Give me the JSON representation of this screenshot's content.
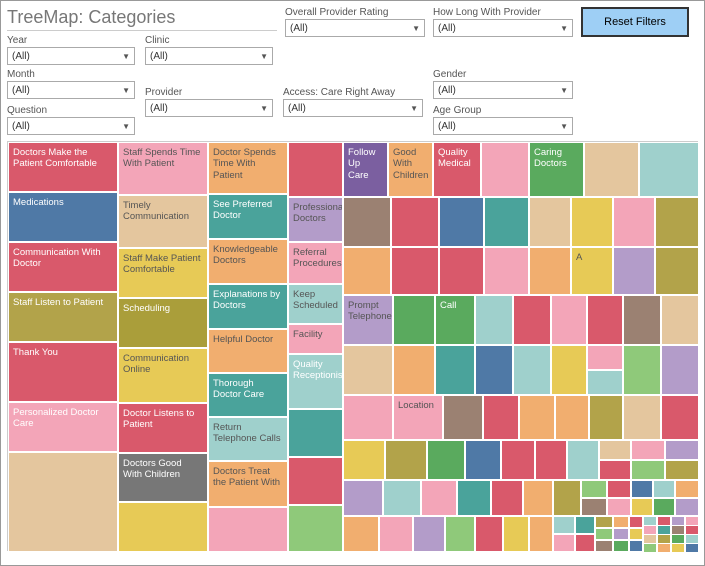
{
  "title": "TreeMap: Categories",
  "reset_button": "Reset Filters",
  "filters": {
    "year": {
      "label": "Year",
      "value": "(All)"
    },
    "clinic": {
      "label": "Clinic",
      "value": "(All)"
    },
    "month": {
      "label": "Month",
      "value": "(All)"
    },
    "provider": {
      "label": "Provider",
      "value": "(All)"
    },
    "question": {
      "label": "Question",
      "value": "(All)"
    },
    "overall_rating": {
      "label": "Overall Provider Rating",
      "value": "(All)"
    },
    "how_long": {
      "label": "How Long With Provider",
      "value": "(All)"
    },
    "access": {
      "label": "Access: Care Right Away",
      "value": "(All)"
    },
    "gender": {
      "label": "Gender",
      "value": "(All)"
    },
    "age_group": {
      "label": "Age Group",
      "value": "(All)"
    }
  },
  "chart_data": {
    "type": "treemap",
    "title": "TreeMap: Categories",
    "series": [
      {
        "name": "Doctors Make the Patient Comfortable",
        "value": 100,
        "color": "#d9596b"
      },
      {
        "name": "Medications",
        "value": 90,
        "color": "#4f79a6"
      },
      {
        "name": "Communication With Doctor",
        "value": 88,
        "color": "#d9596b"
      },
      {
        "name": "Staff Listen to Patient",
        "value": 85,
        "color": "#b2a34a"
      },
      {
        "name": "Thank You",
        "value": 84,
        "color": "#d9596b"
      },
      {
        "name": "Personalized Doctor Care",
        "value": 70,
        "color": "#f3a5b8"
      },
      {
        "name": "Staff Spends Time With Patient",
        "value": 78,
        "color": "#f3a5b8"
      },
      {
        "name": "Timely Communication",
        "value": 72,
        "color": "#e4c69e"
      },
      {
        "name": "Staff Make Patient Comfortable",
        "value": 70,
        "color": "#e7ca56"
      },
      {
        "name": "Scheduling",
        "value": 68,
        "color": "#aa9e3a"
      },
      {
        "name": "Communication Online",
        "value": 65,
        "color": "#e7ca56"
      },
      {
        "name": "Doctor Listens to Patient",
        "value": 60,
        "color": "#d9596b"
      },
      {
        "name": "Doctors Good With Children",
        "value": 55,
        "color": "#777"
      },
      {
        "name": "Doctor Spends Time With Patient",
        "value": 62,
        "color": "#f1ae6f"
      },
      {
        "name": "See Preferred Doctor",
        "value": 55,
        "color": "#4aa39b"
      },
      {
        "name": "Knowledgeable Doctors",
        "value": 52,
        "color": "#f1ae6f"
      },
      {
        "name": "Explanations by Doctors",
        "value": 50,
        "color": "#4aa39b"
      },
      {
        "name": "Helpful Doctor",
        "value": 48,
        "color": "#f1ae6f"
      },
      {
        "name": "Thorough Doctor Care",
        "value": 46,
        "color": "#4aa39b"
      },
      {
        "name": "Return Telephone Calls",
        "value": 44,
        "color": "#9fd0cc"
      },
      {
        "name": "Doctors Treat the Patient With",
        "value": 42,
        "color": "#f1ae6f"
      },
      {
        "name": "Professional Doctors",
        "value": 42,
        "color": "#b39cc9"
      },
      {
        "name": "Referral Procedures",
        "value": 40,
        "color": "#f3a5b8"
      },
      {
        "name": "Keep Scheduled",
        "value": 38,
        "color": "#9fd0cc"
      },
      {
        "name": "Facility",
        "value": 36,
        "color": "#f3a5b8"
      },
      {
        "name": "Quality Receptionists",
        "value": 40,
        "color": "#9fd0cc"
      },
      {
        "name": "Follow Up Care",
        "value": 40,
        "color": "#7b5fa0"
      },
      {
        "name": "Good With Children",
        "value": 38,
        "color": "#f1ae6f"
      },
      {
        "name": "Quality Medical",
        "value": 38,
        "color": "#d9596b"
      },
      {
        "name": "Caring Doctors",
        "value": 36,
        "color": "#5aaa5e"
      },
      {
        "name": "Prompt Telephone",
        "value": 35,
        "color": "#b39cc9"
      },
      {
        "name": "Location",
        "value": 30,
        "color": "#f3a5b8"
      },
      {
        "name": "Call",
        "value": 28,
        "color": "#5aaa5e"
      },
      {
        "name": "A",
        "value": 26,
        "color": "#e7ca56"
      }
    ]
  }
}
